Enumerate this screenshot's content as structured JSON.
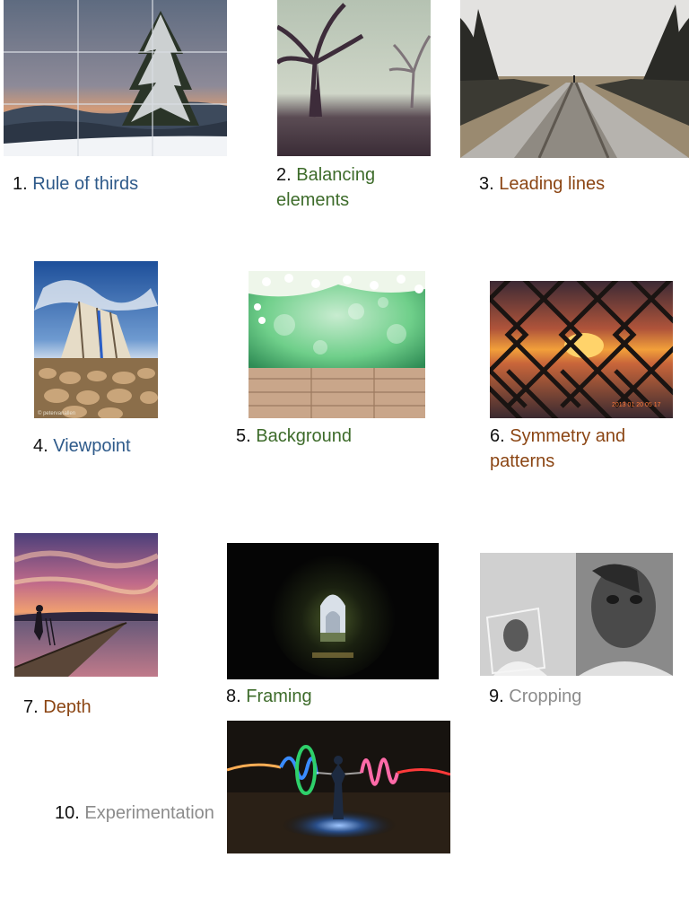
{
  "items": [
    {
      "num": "1.",
      "label": "Rule of thirds",
      "color": "#2e5a8a"
    },
    {
      "num": "2.",
      "label": "Balancing",
      "label2": "elements",
      "color": "#3d6b2a"
    },
    {
      "num": "3.",
      "label": "Leading lines",
      "color": "#8b4513"
    },
    {
      "num": "4.",
      "label": "Viewpoint",
      "color": "#2e5a8a"
    },
    {
      "num": "5.",
      "label": "Background",
      "color": "#3d6b2a"
    },
    {
      "num": "6.",
      "label": "Symmetry and",
      "label2": "patterns",
      "color": "#8b4513"
    },
    {
      "num": "7.",
      "label": "Depth",
      "color": "#8b4513"
    },
    {
      "num": "8.",
      "label": "Framing",
      "color": "#3d6b2a"
    },
    {
      "num": "9.",
      "label": "Cropping",
      "color": "#8c8c8c"
    },
    {
      "num": "10.",
      "label": "Experimentation",
      "color": "#8c8c8c"
    }
  ],
  "watermarks": {
    "viewpoint": "© petervanallen",
    "symmetry": "2013 01 20 05 17"
  }
}
